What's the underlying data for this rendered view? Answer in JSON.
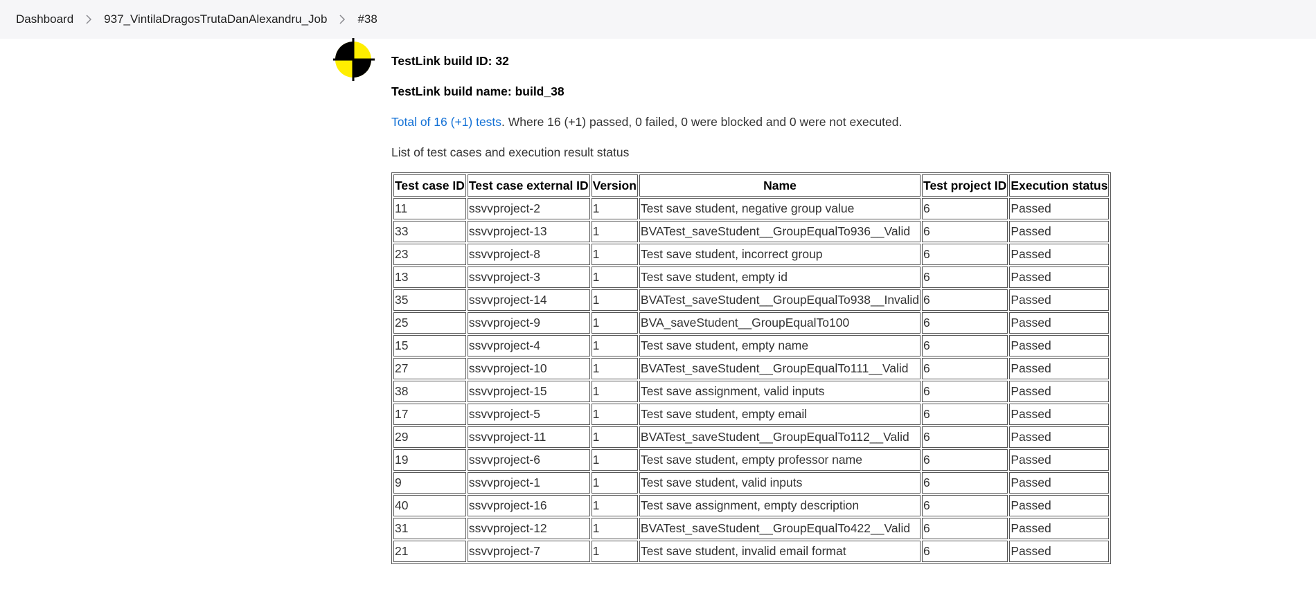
{
  "breadcrumb": {
    "items": [
      "Dashboard",
      "937_VintilaDragosTrutaDanAlexandru_Job",
      "#38"
    ]
  },
  "build": {
    "id_line": "TestLink build ID: 32",
    "name_line": "TestLink build name: build_38",
    "total_link": "Total of 16 (+1) tests",
    "summary_rest": ". Where 16 (+1) passed, 0 failed, 0 were blocked and 0 were not executed.",
    "list_caption": "List of test cases and execution result status"
  },
  "table": {
    "headers": [
      "Test case ID",
      "Test case external ID",
      "Version",
      "Name",
      "Test project ID",
      "Execution status"
    ],
    "rows": [
      [
        "11",
        "ssvvproject-2",
        "1",
        "Test save student, negative group value",
        "6",
        "Passed"
      ],
      [
        "33",
        "ssvvproject-13",
        "1",
        "BVATest_saveStudent__GroupEqualTo936__Valid",
        "6",
        "Passed"
      ],
      [
        "23",
        "ssvvproject-8",
        "1",
        "Test save student, incorrect group",
        "6",
        "Passed"
      ],
      [
        "13",
        "ssvvproject-3",
        "1",
        "Test save student, empty id",
        "6",
        "Passed"
      ],
      [
        "35",
        "ssvvproject-14",
        "1",
        "BVATest_saveStudent__GroupEqualTo938__Invalid",
        "6",
        "Passed"
      ],
      [
        "25",
        "ssvvproject-9",
        "1",
        "BVA_saveStudent__GroupEqualTo100",
        "6",
        "Passed"
      ],
      [
        "15",
        "ssvvproject-4",
        "1",
        "Test save student, empty name",
        "6",
        "Passed"
      ],
      [
        "27",
        "ssvvproject-10",
        "1",
        "BVATest_saveStudent__GroupEqualTo111__Valid",
        "6",
        "Passed"
      ],
      [
        "38",
        "ssvvproject-15",
        "1",
        "Test save assignment, valid inputs",
        "6",
        "Passed"
      ],
      [
        "17",
        "ssvvproject-5",
        "1",
        "Test save student, empty email",
        "6",
        "Passed"
      ],
      [
        "29",
        "ssvvproject-11",
        "1",
        "BVATest_saveStudent__GroupEqualTo112__Valid",
        "6",
        "Passed"
      ],
      [
        "19",
        "ssvvproject-6",
        "1",
        "Test save student, empty professor name",
        "6",
        "Passed"
      ],
      [
        "9",
        "ssvvproject-1",
        "1",
        "Test save student, valid inputs",
        "6",
        "Passed"
      ],
      [
        "40",
        "ssvvproject-16",
        "1",
        "Test save assignment, empty description",
        "6",
        "Passed"
      ],
      [
        "31",
        "ssvvproject-12",
        "1",
        "BVATest_saveStudent__GroupEqualTo422__Valid",
        "6",
        "Passed"
      ],
      [
        "21",
        "ssvvproject-7",
        "1",
        "Test save student, invalid email format",
        "6",
        "Passed"
      ]
    ]
  },
  "colors": {
    "link": "#1572d6",
    "passed": "#1f8b1f",
    "logo_yellow": "#ffee00"
  },
  "icons": {
    "logo": "testlink-logo-icon",
    "separator": "chevron-right-icon"
  }
}
